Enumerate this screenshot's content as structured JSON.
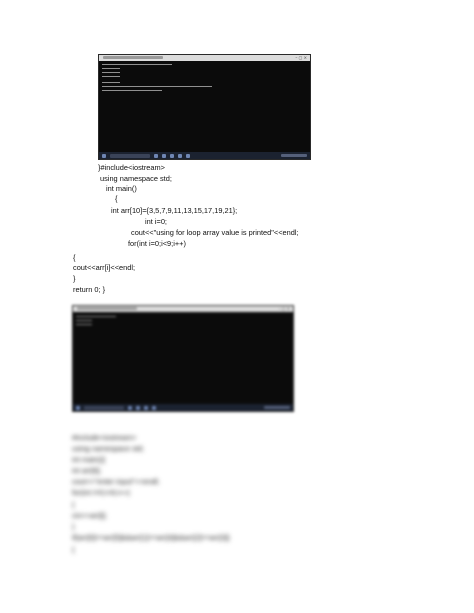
{
  "code_block": [
    "}#include<iostream>",
    "using namespace std;",
    "int main()",
    "{",
    "int arr[10]={3,5,7,9,11,13,15,17,19,21};",
    "int i=0;",
    "cout<<\"using for loop array value is printed\"<<endl;",
    "for(int i=0;i<9;i++)",
    "{",
    "cout<<arr[i]<<endl;",
    "}",
    "return 0; }"
  ],
  "blurred_code_block": [
    "#include<iostream>",
    "using namespace std;",
    "int main(){",
    "int arr[6];",
    "cout<<\"enter input\"<<endl;",
    "for(int i=0;i<6;i++)",
    "{",
    "cin>>arr[i];",
    "}",
    "if(arr[0]==arr[5]&&arr[1]==arr[4]&&arr[2]==arr[3])",
    "{"
  ],
  "screenshot_icons": [
    "console-window",
    "windows-taskbar"
  ]
}
